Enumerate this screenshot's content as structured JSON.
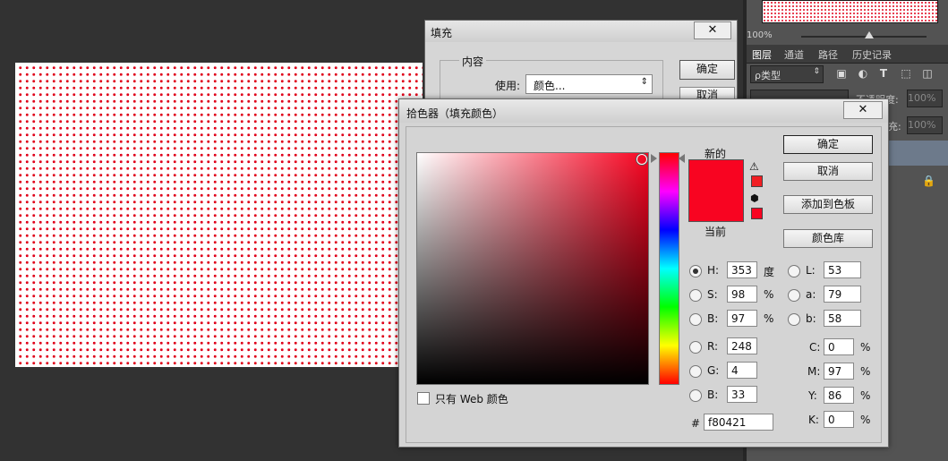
{
  "right_panel": {
    "zoom": "100%",
    "tabs": [
      "图层",
      "通道",
      "路径",
      "历史记录"
    ],
    "kind_filter": "ρ类型",
    "filter_icons": [
      "image-icon",
      "adjustment-icon",
      "type-icon",
      "shape-icon",
      "smart-object-icon"
    ],
    "opacity_label": "不透明度:",
    "opacity_value": "100%",
    "fill_label": "充:",
    "fill_value": "100%"
  },
  "fill_dialog": {
    "title": "填充",
    "close": "✕",
    "content_label": "内容",
    "use_label": "使用:",
    "use_value": "颜色...",
    "ok": "确定",
    "cancel": "取消"
  },
  "color_picker": {
    "title": "拾色器（填充颜色）",
    "close": "✕",
    "new_label": "新的",
    "current_label": "当前",
    "new_color": "#f80421",
    "current_color": "#f80421",
    "buttons": {
      "ok": "确定",
      "cancel": "取消",
      "add_swatch": "添加到色板",
      "libraries": "颜色库"
    },
    "web_only_label": "只有 Web 颜色",
    "fields": {
      "H": {
        "label": "H:",
        "value": "353",
        "unit": "度"
      },
      "S": {
        "label": "S:",
        "value": "98",
        "unit": "%"
      },
      "Bv": {
        "label": "B:",
        "value": "97",
        "unit": "%"
      },
      "R": {
        "label": "R:",
        "value": "248"
      },
      "G": {
        "label": "G:",
        "value": "4"
      },
      "Bb": {
        "label": "B:",
        "value": "33"
      },
      "L": {
        "label": "L:",
        "value": "53"
      },
      "a": {
        "label": "a:",
        "value": "79"
      },
      "b": {
        "label": "b:",
        "value": "58"
      },
      "C": {
        "label": "C:",
        "value": "0",
        "unit": "%"
      },
      "M": {
        "label": "M:",
        "value": "97",
        "unit": "%"
      },
      "Y": {
        "label": "Y:",
        "value": "86",
        "unit": "%"
      },
      "K": {
        "label": "K:",
        "value": "0",
        "unit": "%"
      }
    },
    "hex_label": "#",
    "hex_value": "f80421"
  }
}
